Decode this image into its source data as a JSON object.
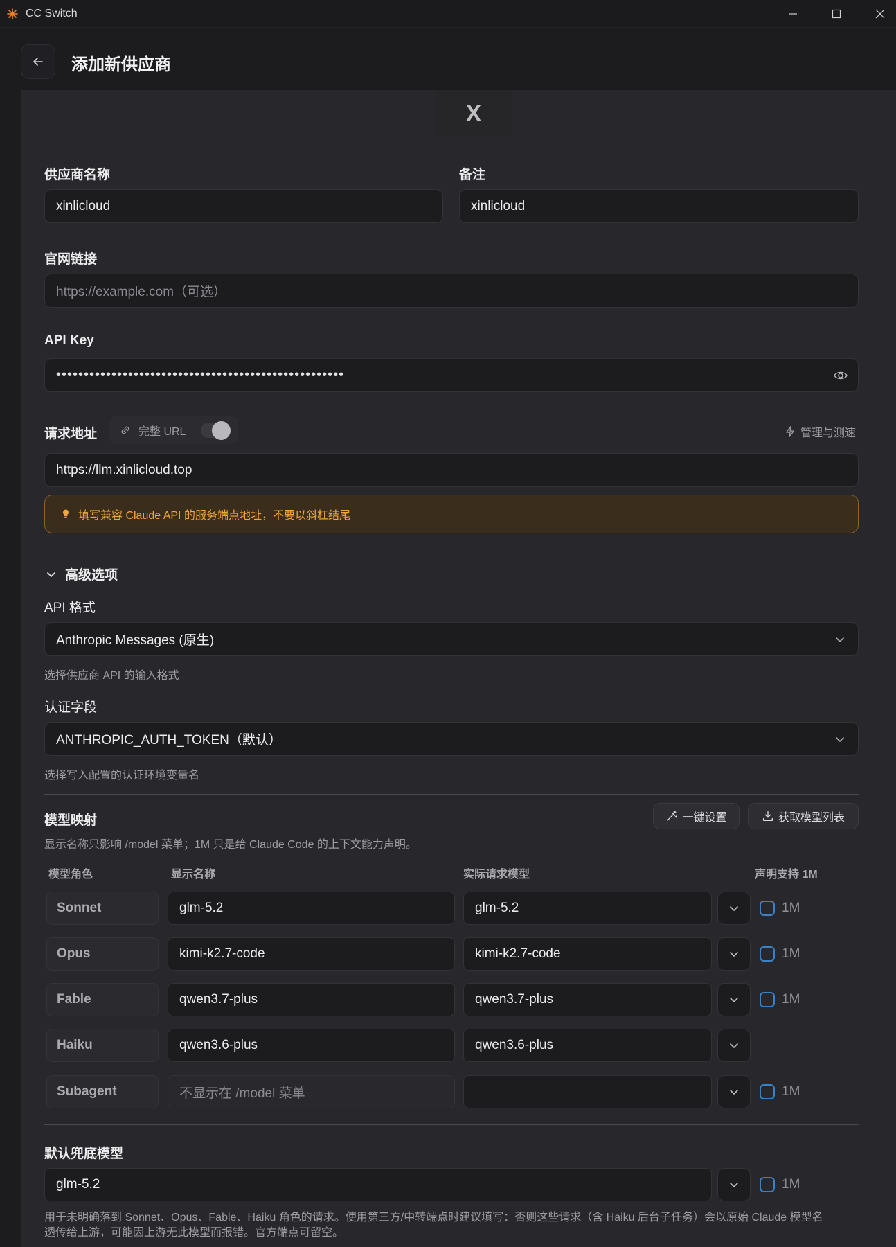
{
  "window": {
    "title": "CC Switch"
  },
  "header": {
    "title": "添加新供应商"
  },
  "logo": {
    "letter": "X"
  },
  "form": {
    "provider_name_label": "供应商名称",
    "provider_name_value": "xinlicloud",
    "notes_label": "备注",
    "notes_value": "xinlicloud",
    "website_label": "官网链接",
    "website_placeholder": "https://example.com（可选）",
    "api_key_label": "API Key",
    "api_key_masked": "••••••••••••••••••••••••••••••••••••••••••••••••••••",
    "endpoint_label": "请求地址",
    "full_url_label": "完整 URL",
    "manage_label": "管理与测速",
    "endpoint_value": "https://llm.xinlicloud.top",
    "endpoint_warning": "填写兼容 Claude API 的服务端点地址，不要以斜杠结尾"
  },
  "advanced": {
    "toggle_label": "高级选项",
    "api_format_label": "API 格式",
    "api_format_value": "Anthropic Messages (原生)",
    "api_format_hint": "选择供应商 API 的输入格式",
    "auth_field_label": "认证字段",
    "auth_field_value": "ANTHROPIC_AUTH_TOKEN（默认）",
    "auth_field_hint": "选择写入配置的认证环境变量名"
  },
  "mapping": {
    "title": "模型映射",
    "subtitle": "显示名称只影响 /model 菜单；1M 只是给 Claude Code 的上下文能力声明。",
    "one_click_label": "一键设置",
    "fetch_label": "获取模型列表",
    "columns": [
      "模型角色",
      "显示名称",
      "实际请求模型",
      "声明支持 1M"
    ],
    "rows": [
      {
        "role": "Sonnet",
        "display": "glm-5.2",
        "model": "glm-5.2",
        "has_1m": true,
        "one_m": "1M"
      },
      {
        "role": "Opus",
        "display": "kimi-k2.7-code",
        "model": "kimi-k2.7-code",
        "has_1m": true,
        "one_m": "1M"
      },
      {
        "role": "Fable",
        "display": "qwen3.7-plus",
        "model": "qwen3.7-plus",
        "has_1m": true,
        "one_m": "1M"
      },
      {
        "role": "Haiku",
        "display": "qwen3.6-plus",
        "model": "qwen3.6-plus",
        "has_1m": false,
        "one_m": ""
      },
      {
        "role": "Subagent",
        "display": "不显示在 /model 菜单",
        "model": "",
        "has_1m": true,
        "one_m": "1M"
      }
    ]
  },
  "fallback": {
    "label": "默认兜底模型",
    "value": "glm-5.2",
    "one_m": "1M",
    "hint_line1": "用于未明确落到 Sonnet、Opus、Fable、Haiku 角色的请求。使用第三方/中转端点时建议填写：否则这些请求（含 Haiku 后台子任务）会以原始 Claude 模型名",
    "hint_line2": "透传给上游，可能因上游无此模型而报错。官方端点可留空。"
  },
  "colors": {
    "accent_blue": "#3b82c4",
    "warning_text": "#f0a838",
    "warning_bg": "#3b2d1b"
  }
}
